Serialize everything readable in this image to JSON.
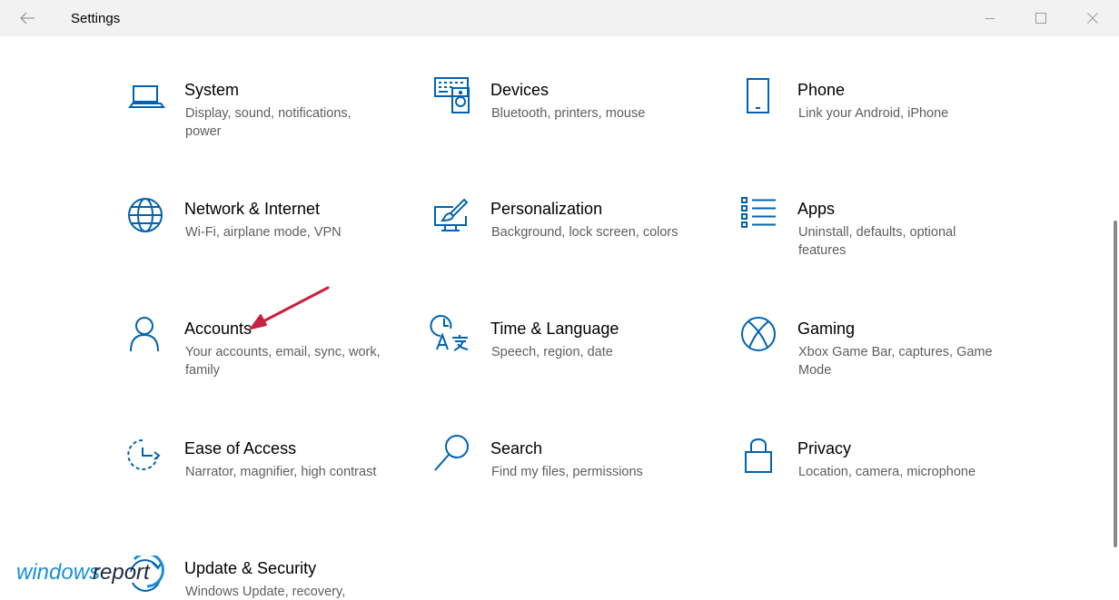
{
  "window": {
    "title": "Settings"
  },
  "tiles": [
    {
      "name": "System",
      "desc": "Display, sound, notifications, power",
      "icon": "laptop-icon"
    },
    {
      "name": "Devices",
      "desc": "Bluetooth, printers, mouse",
      "icon": "keyboard-speaker-icon"
    },
    {
      "name": "Phone",
      "desc": "Link your Android, iPhone",
      "icon": "phone-icon"
    },
    {
      "name": "Network & Internet",
      "desc": "Wi-Fi, airplane mode, VPN",
      "icon": "globe-icon"
    },
    {
      "name": "Personalization",
      "desc": "Background, lock screen, colors",
      "icon": "brush-monitor-icon"
    },
    {
      "name": "Apps",
      "desc": "Uninstall, defaults, optional features",
      "icon": "apps-list-icon"
    },
    {
      "name": "Accounts",
      "desc": "Your accounts, email, sync, work, family",
      "icon": "person-icon"
    },
    {
      "name": "Time & Language",
      "desc": "Speech, region, date",
      "icon": "clock-language-icon"
    },
    {
      "name": "Gaming",
      "desc": "Xbox Game Bar, captures, Game Mode",
      "icon": "xbox-icon"
    },
    {
      "name": "Ease of Access",
      "desc": "Narrator, magnifier, high contrast",
      "icon": "ease-of-access-icon"
    },
    {
      "name": "Search",
      "desc": "Find my files, permissions",
      "icon": "magnifier-icon"
    },
    {
      "name": "Privacy",
      "desc": "Location, camera, microphone",
      "icon": "lock-icon"
    },
    {
      "name": "Update & Security",
      "desc": "Windows Update, recovery,",
      "icon": "update-icon"
    }
  ],
  "watermark": {
    "part1": "windows",
    "part2": "report"
  },
  "colors": {
    "accent": "#0063b1",
    "annotation": "#c8213e"
  }
}
